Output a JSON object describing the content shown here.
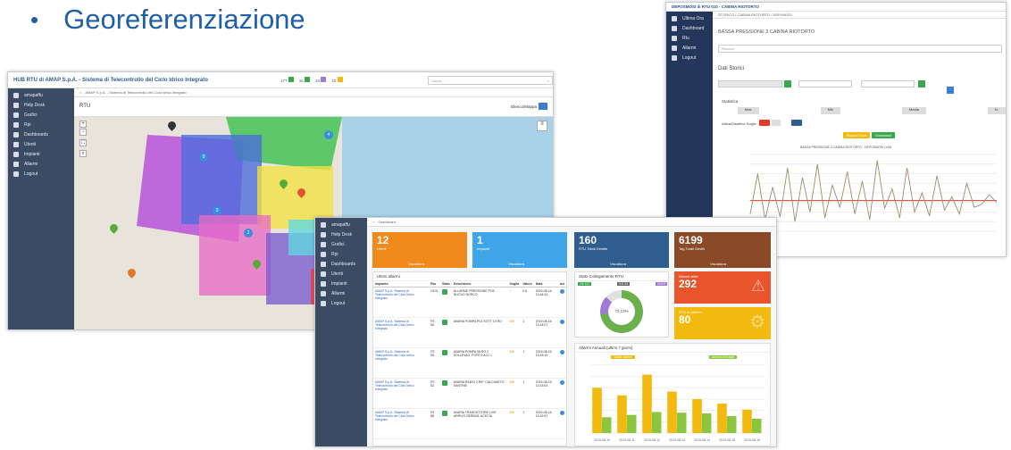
{
  "slide": {
    "bullet": "•",
    "title": "Georeferenziazione"
  },
  "map_shot": {
    "title": "HUB RTU di AMAP S.p.A. - Sistema di Telecontrollo del Ciclo Idrico Integrato",
    "search_placeholder": "Cerca...",
    "breadcrumb": "AMAP S.p.A. - Sistema di Telecontrollo del Ciclo Idrico Integrato",
    "section": "RTU",
    "view_label": "Elenco/Mappa",
    "menu": [
      "amapaffu",
      "Help Desk",
      "Grafici",
      "Rpi",
      "Dashboards",
      "Utenti",
      "Impianti",
      "Allarmi",
      "Logout"
    ],
    "top_counters": [
      "177",
      "15",
      "24",
      "10"
    ]
  },
  "history_shot": {
    "window_title": "DEPOSMOSI di RTU 010 - CABINA RIOTORTO",
    "breadcrumb": "STORICO / CABINA RIOTORTO / DEP.MASSI",
    "heading": "BASSA PRESSIONE 3 CABINA RIOTORTO",
    "select_placeholder": "Ricerca",
    "section": "Dati Storici",
    "stats_label": "Statistica",
    "thresholds_label": "Attiva/Disattiva Soglie",
    "chart_title": "BASSA PRESSIONE 3 CABINA RIOTORTO - DEPOSMOSI (145)",
    "menu": [
      "Ultima Ora",
      "Dashboard",
      "Rtu",
      "Allarmi",
      "Logout"
    ],
    "stats": [
      "Max",
      "Min",
      "Media",
      "N."
    ],
    "btn_report": "Report Excel",
    "btn_download": "Download"
  },
  "dash_shot": {
    "breadcrumb": "Dashboard",
    "menu": [
      "amapaffu",
      "Help Desk",
      "Grafici",
      "Rpi",
      "Dashboards",
      "Utenti",
      "Impianti",
      "Allarmi",
      "Logout"
    ],
    "cards": [
      {
        "value": "12",
        "label": "Utenti",
        "link": "Visualizza",
        "color": "#f08a1c"
      },
      {
        "value": "1",
        "label": "Impianti",
        "link": "Visualizza",
        "color": "#3fa4e8"
      },
      {
        "value": "160",
        "label": "RTU Totali Gestite",
        "link": "Visualizza",
        "color": "#2f5d8f"
      },
      {
        "value": "6199",
        "label": "Tag Totali Gestiti",
        "link": "Visualizza",
        "color": "#8a4a28"
      }
    ],
    "alarm_cards": [
      {
        "label": "Allarmi attivi",
        "value": "292",
        "color": "#e8542b"
      },
      {
        "label": "RTU in allarme",
        "value": "80",
        "color": "#f2b90f"
      }
    ],
    "table_title": "Ultimi allarmi",
    "table_headers": [
      "Impianto",
      "Rtu",
      "Stato",
      "Descrizione",
      "Soglia",
      "Valore",
      "Data",
      "Azi"
    ],
    "rows": [
      [
        "AMAP S.p.A. Sistema di Telecontrollo del Ciclo Idrico Integrato",
        "H101",
        "",
        "ALLARME PRESSIONE POZ. NUOVO NORCO",
        "!",
        "0.6",
        "2019-08-16 13:44:24"
      ],
      [
        "AMAP S.p.A. Sistema di Telecontrollo del Ciclo Idrico Integrato",
        "RT-56",
        "",
        "AVARIA POMPA P02 SOTT. DI RO",
        "2/5",
        "1",
        "2019-08-16 13:44:07"
      ],
      [
        "AMAP S.p.A. Sistema di Telecontrollo del Ciclo Idrico Integrato",
        "RT-56",
        "",
        "AVARIA POMPA 06 RO 2 SOLLEVAG. PORTO ACC.I",
        "2/5",
        "1",
        "2019-08-16 13:43:19"
      ],
      [
        "AMAP S.p.A. Sistema di Telecontrollo del Ciclo Idrico Integrato",
        "RT-62",
        "",
        "AVARIA RADIO 2 RIP. CALCANETO SANTINE",
        "2/5",
        "1",
        "2019-08-16 13:43:04"
      ],
      [
        "AMAP S.p.A. Sistema di Telecontrollo del Ciclo Idrico Integrato",
        "RT-88",
        "",
        "AVARIA TRASDUTTORE LIVE ARRIVO SERBOIL ACECIA",
        "2/5",
        "1",
        "2019-08-16 13:42:57"
      ]
    ],
    "donut_title": "Stato Collegamento RTU",
    "donut_pct": "73,13%",
    "donut_badges": [
      "Ok 117",
      "KO 34",
      "N.A 9"
    ],
    "bar_title": "Allarmi Annuali (ultimi 7 giorni)",
    "bar_legend": [
      "Totale allarmi",
      "Allarmi Annullati"
    ]
  },
  "chart_data": [
    {
      "type": "line",
      "title": "BASSA PRESSIONE 3 CABINA RIOTORTO - DEPOSMOSI (145)",
      "ylabel": "",
      "ylim": [
        0,
        80
      ],
      "y": [
        18,
        60,
        12,
        46,
        15,
        66,
        10,
        56,
        20,
        70,
        14,
        48,
        25,
        62,
        18,
        52,
        12,
        74,
        24,
        44,
        14,
        66,
        20,
        40,
        16,
        58,
        22,
        36,
        18,
        50,
        25,
        28,
        38,
        30
      ],
      "threshold": 32
    },
    {
      "type": "bar",
      "title": "Allarmi Annuali (ultimi 7 giorni)",
      "categories": [
        "2019-08-10",
        "2019-08-11",
        "2019-08-12",
        "2019-08-13",
        "2019-08-14",
        "2019-08-15",
        "2019-08-16"
      ],
      "series": [
        {
          "name": "Totale allarmi",
          "values": [
            1200,
            1000,
            1550,
            1100,
            900,
            780,
            620
          ],
          "color": "#f2b90f"
        },
        {
          "name": "Allarmi Annullati",
          "values": [
            420,
            480,
            560,
            540,
            520,
            450,
            380
          ],
          "color": "#8cc63f"
        }
      ],
      "ylim": [
        0,
        1800
      ]
    }
  ]
}
